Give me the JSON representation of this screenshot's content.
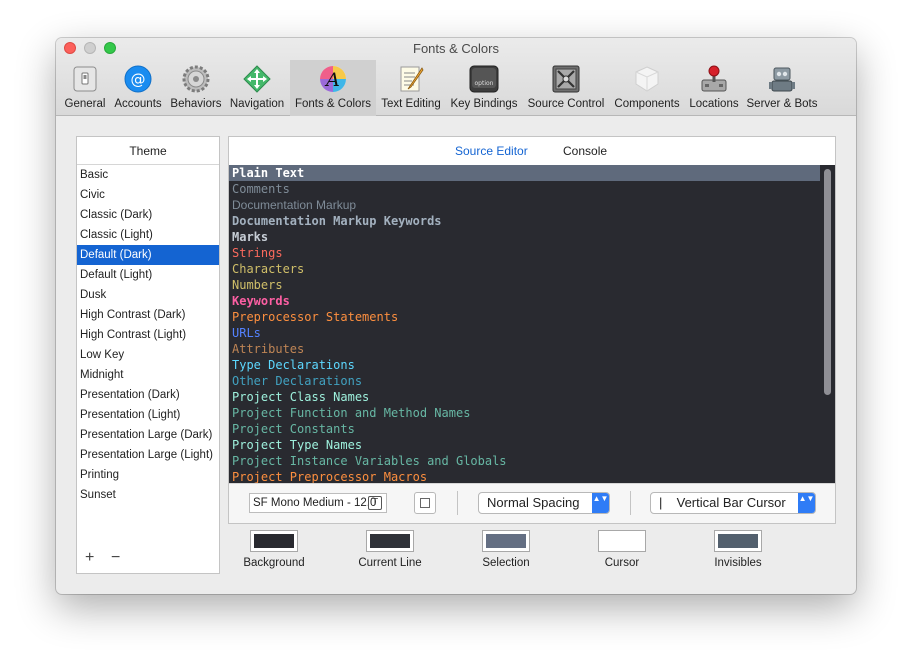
{
  "window": {
    "title": "Fonts & Colors"
  },
  "toolbar": [
    {
      "label": "General",
      "icon": "general-icon"
    },
    {
      "label": "Accounts",
      "icon": "accounts-icon"
    },
    {
      "label": "Behaviors",
      "icon": "behaviors-icon"
    },
    {
      "label": "Navigation",
      "icon": "navigation-icon"
    },
    {
      "label": "Fonts & Colors",
      "icon": "fonts-colors-icon"
    },
    {
      "label": "Text Editing",
      "icon": "text-editing-icon"
    },
    {
      "label": "Key Bindings",
      "icon": "key-bindings-icon"
    },
    {
      "label": "Source Control",
      "icon": "source-control-icon"
    },
    {
      "label": "Components",
      "icon": "components-icon"
    },
    {
      "label": "Locations",
      "icon": "locations-icon"
    },
    {
      "label": "Server & Bots",
      "icon": "server-bots-icon"
    }
  ],
  "theme": {
    "header": "Theme",
    "items": [
      "Basic",
      "Civic",
      "Classic (Dark)",
      "Classic (Light)",
      "Default (Dark)",
      "Default (Light)",
      "Dusk",
      "High Contrast (Dark)",
      "High Contrast (Light)",
      "Low Key",
      "Midnight",
      "Presentation (Dark)",
      "Presentation (Light)",
      "Presentation Large (Dark)",
      "Presentation Large (Light)",
      "Printing",
      "Sunset"
    ],
    "selected_index": 4,
    "add_symbol": "+",
    "remove_symbol": "−"
  },
  "editor": {
    "tab_source": "Source Editor",
    "tab_console": "Console",
    "syntax": [
      {
        "label": "Plain Text",
        "color": "#ffffff",
        "bold": true
      },
      {
        "label": "Comments",
        "color": "#7f8c98",
        "bold": false
      },
      {
        "label": "Documentation Markup",
        "color": "#7f8c98",
        "bold": false,
        "sans": true
      },
      {
        "label": "Documentation Markup Keywords",
        "color": "#a3b1bf",
        "bold": true
      },
      {
        "label": "Marks",
        "color": "#c6cdd5",
        "bold": true
      },
      {
        "label": "Strings",
        "color": "#fc6a5d",
        "bold": false
      },
      {
        "label": "Characters",
        "color": "#d0bf69",
        "bold": false
      },
      {
        "label": "Numbers",
        "color": "#d0bf69",
        "bold": false
      },
      {
        "label": "Keywords",
        "color": "#fc5fa3",
        "bold": true
      },
      {
        "label": "Preprocessor Statements",
        "color": "#fd8f3f",
        "bold": false
      },
      {
        "label": "URLs",
        "color": "#5482ff",
        "bold": false
      },
      {
        "label": "Attributes",
        "color": "#bf8555",
        "bold": false
      },
      {
        "label": "Type Declarations",
        "color": "#5dd8ff",
        "bold": false
      },
      {
        "label": "Other Declarations",
        "color": "#41a1c0",
        "bold": false
      },
      {
        "label": "Project Class Names",
        "color": "#9ef1dd",
        "bold": false
      },
      {
        "label": "Project Function and Method Names",
        "color": "#67b7a4",
        "bold": false
      },
      {
        "label": "Project Constants",
        "color": "#67b7a4",
        "bold": false
      },
      {
        "label": "Project Type Names",
        "color": "#9ef1dd",
        "bold": false
      },
      {
        "label": "Project Instance Variables and Globals",
        "color": "#67b7a4",
        "bold": false
      },
      {
        "label": "Project Preprocessor Macros",
        "color": "#fd8f3f",
        "bold": false
      }
    ],
    "selected_index": 0,
    "font": "SF Mono Medium - 12.0",
    "font_button_glyph": "T",
    "spacing": "Normal Spacing",
    "cursor_style": "Vertical Bar Cursor",
    "cursor_glyph": "|",
    "popup_chevron": "▲▼"
  },
  "swatches": [
    {
      "label": "Background",
      "color": "#292a30"
    },
    {
      "label": "Current Line",
      "color": "#2f3239"
    },
    {
      "label": "Selection",
      "color": "#646f83"
    },
    {
      "label": "Cursor",
      "color": "#ffffff"
    },
    {
      "label": "Invisibles",
      "color": "#53606e"
    }
  ]
}
